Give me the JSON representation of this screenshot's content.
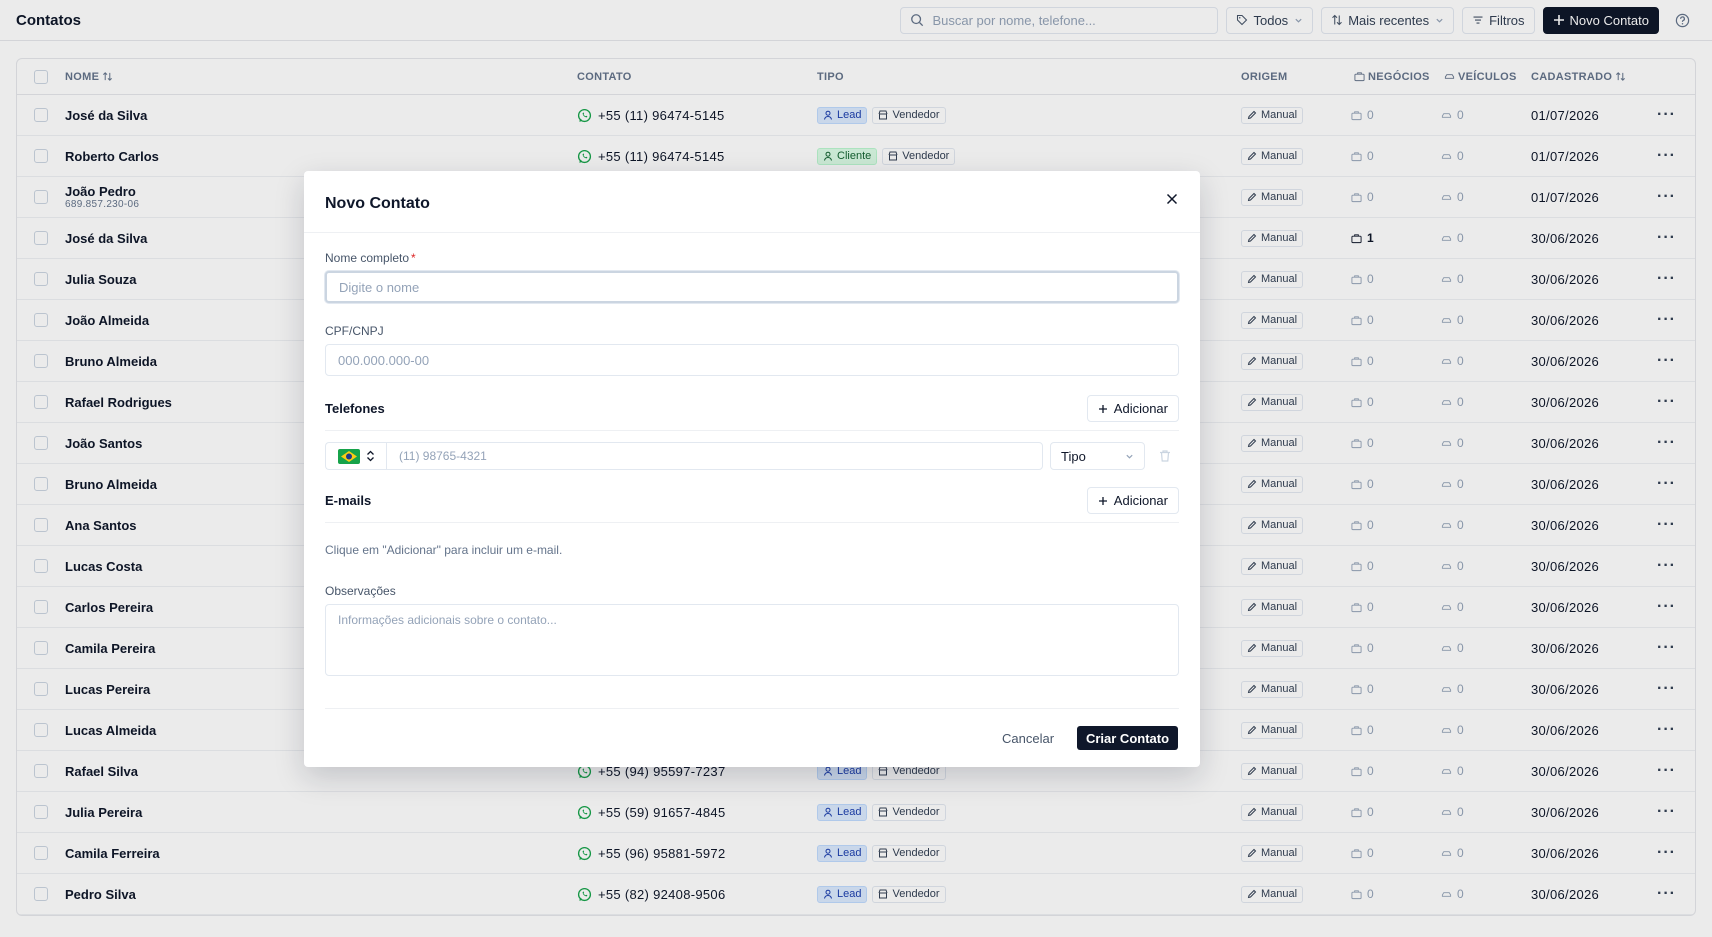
{
  "header": {
    "title": "Contatos",
    "search_placeholder": "Buscar por nome, telefone...",
    "filter_type": "Todos",
    "sort": "Mais recentes",
    "filters": "Filtros",
    "new_contact": "Novo Contato"
  },
  "table": {
    "columns": {
      "nome": "NOME",
      "contato": "CONTATO",
      "tipo": "TIPO",
      "origem": "ORIGEM",
      "negocios": "NEGÓCIOS",
      "veiculos": "VEÍCULOS",
      "cadastrado": "CADASTRADO"
    },
    "rows": [
      {
        "nome": "José da Silva",
        "sub": "",
        "phone": "+55 (11) 96474-5145",
        "tipos": [
          {
            "label": "Lead",
            "kind": "lead"
          },
          {
            "label": "Vendedor",
            "kind": "vendedor"
          }
        ],
        "origem": "Manual",
        "negocios": "0",
        "negocios_on": false,
        "veiculos": "0",
        "cadastrado": "01/07/2026"
      },
      {
        "nome": "Roberto Carlos",
        "sub": "",
        "phone": "+55 (11) 96474-5145",
        "tipos": [
          {
            "label": "Cliente",
            "kind": "cliente"
          },
          {
            "label": "Vendedor",
            "kind": "vendedor"
          }
        ],
        "origem": "Manual",
        "negocios": "0",
        "negocios_on": false,
        "veiculos": "0",
        "cadastrado": "01/07/2026"
      },
      {
        "nome": "João Pedro",
        "sub": "689.857.230-06",
        "phone": "",
        "tipos": [],
        "origem": "Manual",
        "negocios": "0",
        "negocios_on": false,
        "veiculos": "0",
        "cadastrado": "01/07/2026"
      },
      {
        "nome": "José da Silva",
        "sub": "",
        "phone": "",
        "tipos": [],
        "origem": "Manual",
        "negocios": "1",
        "negocios_on": true,
        "veiculos": "0",
        "cadastrado": "30/06/2026"
      },
      {
        "nome": "Julia Souza",
        "sub": "",
        "phone": "",
        "tipos": [],
        "origem": "Manual",
        "negocios": "0",
        "negocios_on": false,
        "veiculos": "0",
        "cadastrado": "30/06/2026"
      },
      {
        "nome": "João Almeida",
        "sub": "",
        "phone": "",
        "tipos": [],
        "origem": "Manual",
        "negocios": "0",
        "negocios_on": false,
        "veiculos": "0",
        "cadastrado": "30/06/2026"
      },
      {
        "nome": "Bruno Almeida",
        "sub": "",
        "phone": "",
        "tipos": [],
        "origem": "Manual",
        "negocios": "0",
        "negocios_on": false,
        "veiculos": "0",
        "cadastrado": "30/06/2026"
      },
      {
        "nome": "Rafael Rodrigues",
        "sub": "",
        "phone": "",
        "tipos": [],
        "origem": "Manual",
        "negocios": "0",
        "negocios_on": false,
        "veiculos": "0",
        "cadastrado": "30/06/2026"
      },
      {
        "nome": "João Santos",
        "sub": "",
        "phone": "",
        "tipos": [],
        "origem": "Manual",
        "negocios": "0",
        "negocios_on": false,
        "veiculos": "0",
        "cadastrado": "30/06/2026"
      },
      {
        "nome": "Bruno Almeida",
        "sub": "",
        "phone": "",
        "tipos": [],
        "origem": "Manual",
        "negocios": "0",
        "negocios_on": false,
        "veiculos": "0",
        "cadastrado": "30/06/2026"
      },
      {
        "nome": "Ana Santos",
        "sub": "",
        "phone": "",
        "tipos": [],
        "origem": "Manual",
        "negocios": "0",
        "negocios_on": false,
        "veiculos": "0",
        "cadastrado": "30/06/2026"
      },
      {
        "nome": "Lucas Costa",
        "sub": "",
        "phone": "",
        "tipos": [],
        "origem": "Manual",
        "negocios": "0",
        "negocios_on": false,
        "veiculos": "0",
        "cadastrado": "30/06/2026"
      },
      {
        "nome": "Carlos Pereira",
        "sub": "",
        "phone": "",
        "tipos": [],
        "origem": "Manual",
        "negocios": "0",
        "negocios_on": false,
        "veiculos": "0",
        "cadastrado": "30/06/2026"
      },
      {
        "nome": "Camila Pereira",
        "sub": "",
        "phone": "",
        "tipos": [],
        "origem": "Manual",
        "negocios": "0",
        "negocios_on": false,
        "veiculos": "0",
        "cadastrado": "30/06/2026"
      },
      {
        "nome": "Lucas Pereira",
        "sub": "",
        "phone": "",
        "tipos": [],
        "origem": "Manual",
        "negocios": "0",
        "negocios_on": false,
        "veiculos": "0",
        "cadastrado": "30/06/2026"
      },
      {
        "nome": "Lucas Almeida",
        "sub": "",
        "phone": "",
        "tipos": [],
        "origem": "Manual",
        "negocios": "0",
        "negocios_on": false,
        "veiculos": "0",
        "cadastrado": "30/06/2026"
      },
      {
        "nome": "Rafael Silva",
        "sub": "",
        "phone": "+55 (94) 95597-7237",
        "tipos": [
          {
            "label": "Lead",
            "kind": "lead"
          },
          {
            "label": "Vendedor",
            "kind": "vendedor"
          }
        ],
        "origem": "Manual",
        "negocios": "0",
        "negocios_on": false,
        "veiculos": "0",
        "cadastrado": "30/06/2026"
      },
      {
        "nome": "Julia Pereira",
        "sub": "",
        "phone": "+55 (59) 91657-4845",
        "tipos": [
          {
            "label": "Lead",
            "kind": "lead"
          },
          {
            "label": "Vendedor",
            "kind": "vendedor"
          }
        ],
        "origem": "Manual",
        "negocios": "0",
        "negocios_on": false,
        "veiculos": "0",
        "cadastrado": "30/06/2026"
      },
      {
        "nome": "Camila Ferreira",
        "sub": "",
        "phone": "+55 (96) 95881-5972",
        "tipos": [
          {
            "label": "Lead",
            "kind": "lead"
          },
          {
            "label": "Vendedor",
            "kind": "vendedor"
          }
        ],
        "origem": "Manual",
        "negocios": "0",
        "negocios_on": false,
        "veiculos": "0",
        "cadastrado": "30/06/2026"
      },
      {
        "nome": "Pedro Silva",
        "sub": "",
        "phone": "+55 (82) 92408-9506",
        "tipos": [
          {
            "label": "Lead",
            "kind": "lead"
          },
          {
            "label": "Vendedor",
            "kind": "vendedor"
          }
        ],
        "origem": "Manual",
        "negocios": "0",
        "negocios_on": false,
        "veiculos": "0",
        "cadastrado": "30/06/2026"
      }
    ]
  },
  "modal": {
    "title": "Novo Contato",
    "nome_label": "Nome completo",
    "nome_required": "*",
    "nome_placeholder": "Digite o nome",
    "cpf_label": "CPF/CNPJ",
    "cpf_placeholder": "000.000.000-00",
    "telefones_title": "Telefones",
    "add_label": "Adicionar",
    "phone_placeholder": "(11) 98765-4321",
    "phone_type": "Tipo",
    "emails_title": "E-mails",
    "emails_hint": "Clique em \"Adicionar\" para incluir um e-mail.",
    "obs_label": "Observações",
    "obs_placeholder": "Informações adicionais sobre o contato...",
    "cancel": "Cancelar",
    "submit": "Criar Contato"
  },
  "colors": {
    "primary": "#0f172a",
    "lead_bg": "#dbeafe",
    "cliente_bg": "#dcfce7",
    "whatsapp": "#16a34a",
    "required": "#dc2626"
  }
}
